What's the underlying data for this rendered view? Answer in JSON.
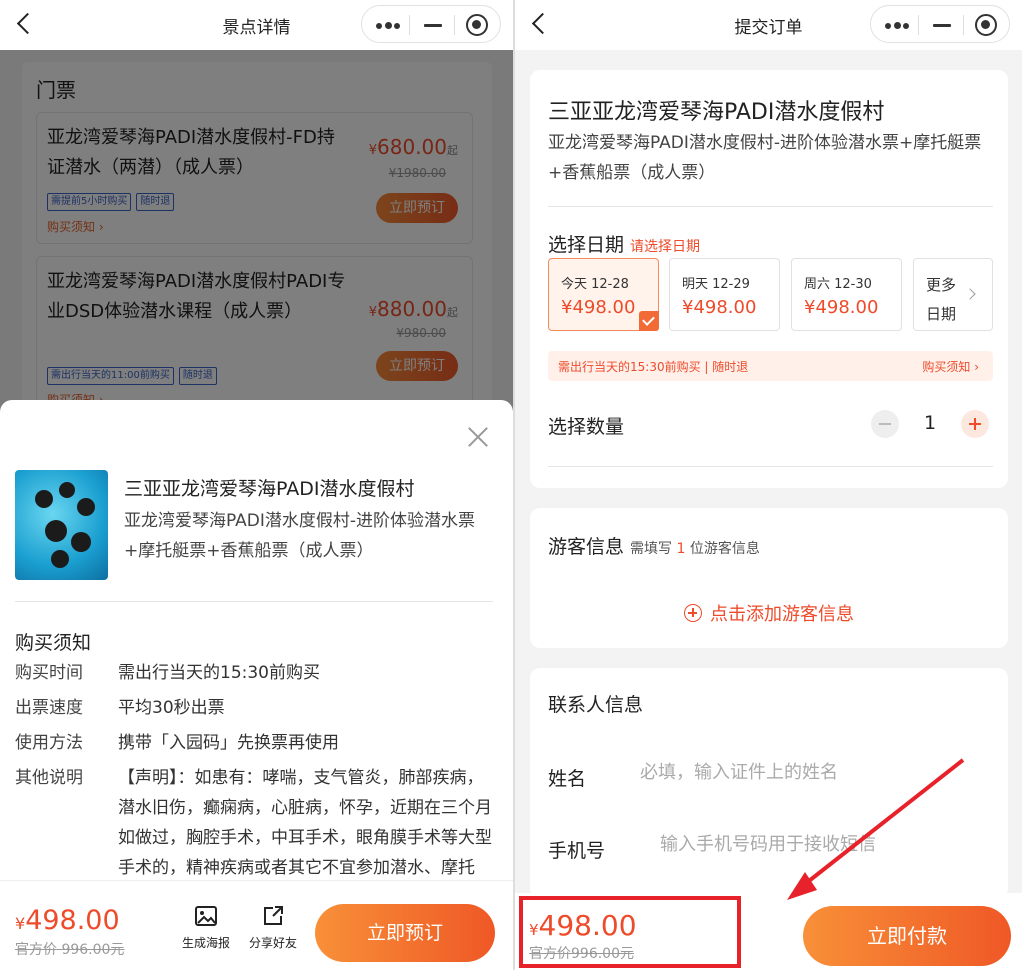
{
  "left": {
    "nav_title": "景点详情",
    "tickets_title": "门票",
    "tickets": [
      {
        "name": "亚龙湾爱琴海PADI潜水度假村-FD持证潜水（两潜）（成人票）",
        "price_symbol": "¥",
        "price": "680.00",
        "price_suffix": "起",
        "original_price": "¥1980.00",
        "tags": [
          "需提前5小时购买",
          "随时退"
        ],
        "notice_link": "购买须知 ›",
        "book_label": "立即预订"
      },
      {
        "name": "亚龙湾爱琴海PADI潜水度假村PADI专业DSD体验潜水课程（成人票）",
        "price_symbol": "¥",
        "price": "880.00",
        "price_suffix": "起",
        "original_price": "¥980.00",
        "tags": [
          "需出行当天的11:00前购买",
          "随时退"
        ],
        "notice_link": "购买须知 ›",
        "book_label": "立即预订"
      }
    ],
    "sheet": {
      "product_title": "三亚亚龙湾爱琴海PADI潜水度假村",
      "product_subtitle": "亚龙湾爱琴海PADI潜水度假村-进阶体验潜水票+摩托艇票+香蕉船票（成人票）",
      "notes_title": "购买须知",
      "notes": [
        {
          "key": "购买时间",
          "value": "需出行当天的15:30前购买"
        },
        {
          "key": "出票速度",
          "value": "平均30秒出票"
        },
        {
          "key": "使用方法",
          "value": "携带「入园码」先换票再使用"
        },
        {
          "key": "其他说明",
          "value": "【声明】：如患有：哮喘，支气管炎，肺部疾病，潜水旧伤，癫痫病，心脏病，怀孕，近期在三个月如做过，胸腔手术，中耳手术，眼角膜手术等大型手术的，精神疾病或者其它不宜参加潜水、摩托艇、水上运动等刺激性项目的活动"
        }
      ],
      "price_symbol": "¥",
      "price": "498.00",
      "original_price": "官方价 996.00元",
      "poster_label": "生成海报",
      "share_label": "分享好友",
      "book_label": "立即预订"
    }
  },
  "right": {
    "nav_title": "提交订单",
    "product_title": "三亚亚龙湾爱琴海PADI潜水度假村",
    "product_subtitle": "亚龙湾爱琴海PADI潜水度假村-进阶体验潜水票+摩托艇票+香蕉船票（成人票）",
    "date_label": "选择日期",
    "date_hint": "请选择日期",
    "dates": [
      {
        "label": "今天 12-28",
        "price": "¥498.00",
        "selected": true
      },
      {
        "label": "明天 12-29",
        "price": "¥498.00",
        "selected": false
      },
      {
        "label": "周六 12-30",
        "price": "¥498.00",
        "selected": false
      }
    ],
    "more_dates": "更多日期",
    "notice_text": "需出行当天的15:30前购买 | 随时退",
    "notice_link": "购买须知 ›",
    "qty_label": "选择数量",
    "qty_value": "1",
    "tourist_label": "游客信息",
    "tourist_hint_prefix": "需填写",
    "tourist_hint_count": "1",
    "tourist_hint_suffix": "位游客信息",
    "add_tourist": "点击添加游客信息",
    "contact_title": "联系人信息",
    "name_label": "姓名",
    "name_placeholder": "必填，输入证件上的姓名",
    "phone_label": "手机号",
    "phone_placeholder": "输入手机号码用于接收短信",
    "price_symbol": "¥",
    "price": "498.00",
    "original_price": "官方价996.00元",
    "pay_label": "立即付款"
  },
  "colors": {
    "accent": "#ee4b2b",
    "button_start": "#f89038",
    "button_end": "#ef5826",
    "highlight": "#e8222a"
  }
}
